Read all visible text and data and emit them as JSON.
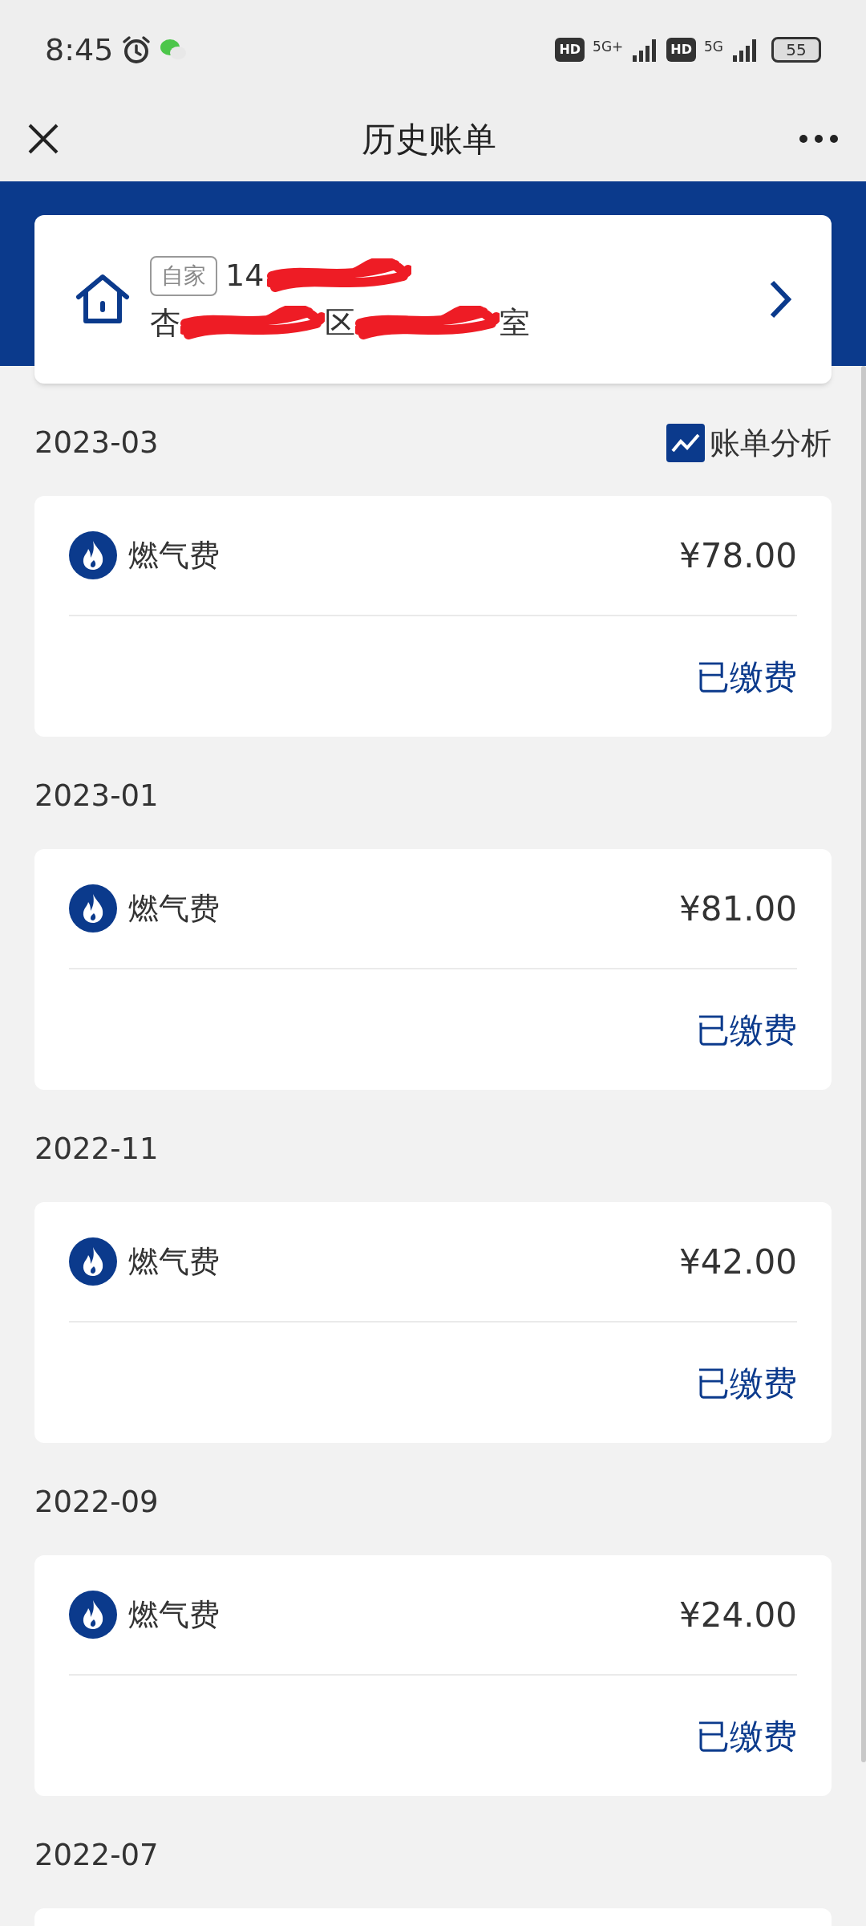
{
  "status_bar": {
    "time": "8:45",
    "hd1": "HD",
    "sim1": "5G+",
    "hd2": "HD",
    "sim2": "5G",
    "battery": "55"
  },
  "header": {
    "title": "历史账单"
  },
  "account": {
    "tag": "自家",
    "line1": "14",
    "line2_parts": [
      "杏",
      "区",
      "室"
    ]
  },
  "analysis_link": "账单分析",
  "months": [
    {
      "date": "2023-03",
      "bills": [
        {
          "name": "燃气费",
          "amount": "¥78.00",
          "status": "已缴费"
        }
      ]
    },
    {
      "date": "2023-01",
      "bills": [
        {
          "name": "燃气费",
          "amount": "¥81.00",
          "status": "已缴费"
        }
      ]
    },
    {
      "date": "2022-11",
      "bills": [
        {
          "name": "燃气费",
          "amount": "¥42.00",
          "status": "已缴费"
        }
      ]
    },
    {
      "date": "2022-09",
      "bills": [
        {
          "name": "燃气费",
          "amount": "¥24.00",
          "status": "已缴费"
        }
      ]
    },
    {
      "date": "2022-07"
    }
  ]
}
